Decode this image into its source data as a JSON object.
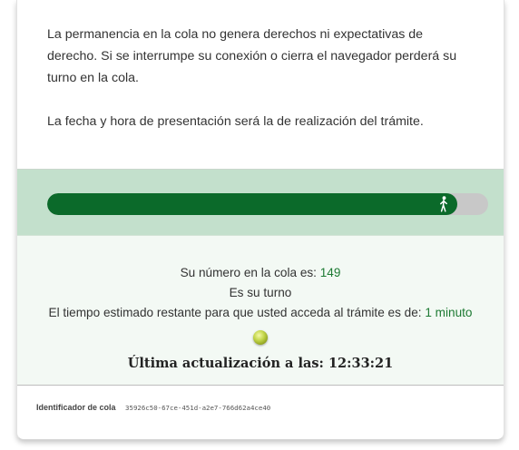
{
  "info": {
    "paragraph1": "La permanencia en la cola no genera derechos ni expectativas de derecho. Si se interrumpe su conexión o cierra el navegador perderá su turno en la cola.",
    "paragraph2": "La fecha y hora de presentación será la de realización del trámite."
  },
  "progress": {
    "fraction": 0.93,
    "icon": "walking-person-icon"
  },
  "status": {
    "queue_label": "Su número en la cola es: ",
    "queue_number": "149",
    "turn_text": "Es su turno",
    "time_label": "El tiempo estimado restante para que usted acceda al trámite es de: ",
    "time_value": "1 minuto",
    "indicator_icon": "status-light-icon",
    "update_label": "Última actualización a las: ",
    "update_time": "12:33:21"
  },
  "footer": {
    "queue_id_label": "Identificador de cola",
    "queue_id": "35926c50-67ce-451d-a2e7-766d62a4ce40"
  },
  "colors": {
    "progress_fill": "#0b6a2a",
    "progress_band": "#c3e0cc",
    "status_background": "#f3f9f4",
    "number_accent": "#1d7a33"
  }
}
